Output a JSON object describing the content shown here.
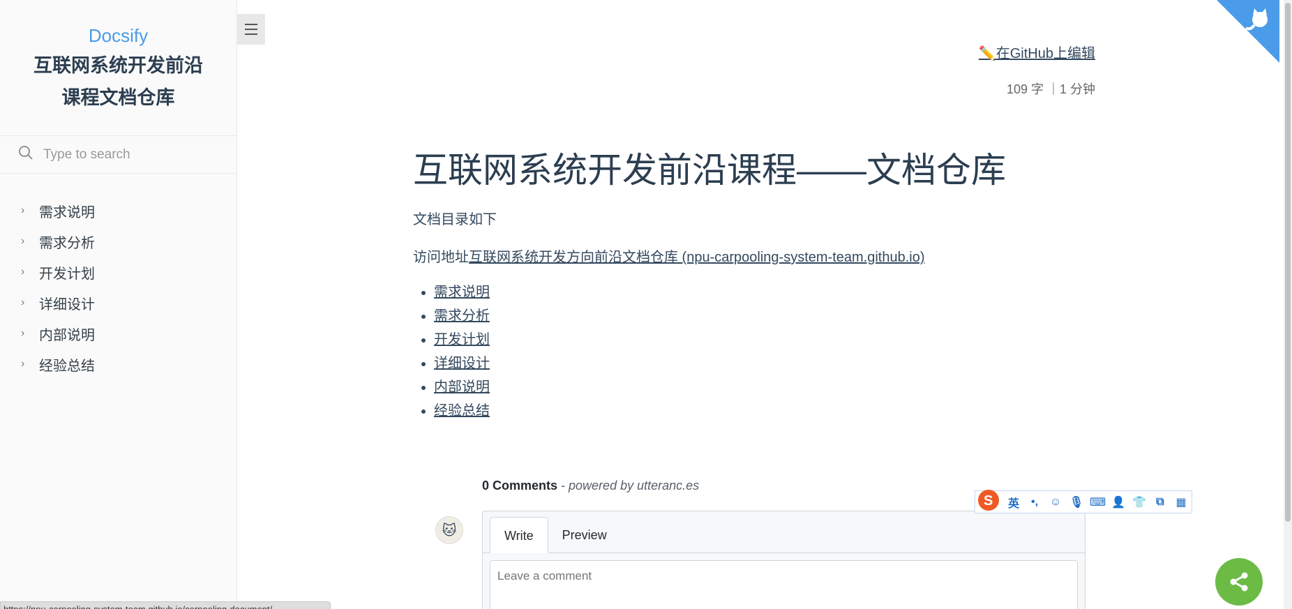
{
  "sidebar": {
    "brand": "Docsify",
    "subtitle_line1": "互联网系统开发前沿",
    "subtitle_line2": "课程文档仓库",
    "search_placeholder": "Type to search",
    "items": [
      {
        "label": "需求说明"
      },
      {
        "label": "需求分析"
      },
      {
        "label": "开发计划"
      },
      {
        "label": "详细设计"
      },
      {
        "label": "内部说明"
      },
      {
        "label": "经验总结"
      }
    ]
  },
  "main": {
    "edit_link": "在GitHub上编辑",
    "word_count": "109 字 ｜1 分钟",
    "title": "互联网系统开发前沿课程——文档仓库",
    "intro": "文档目录如下",
    "visit_prefix": "访问地址",
    "visit_link": "互联网系统开发方向前沿文档仓库 (npu-carpooling-system-team.github.io)",
    "docs": [
      {
        "label": "需求说明"
      },
      {
        "label": "需求分析"
      },
      {
        "label": "开发计划"
      },
      {
        "label": "详细设计"
      },
      {
        "label": "内部说明"
      },
      {
        "label": "经验总结"
      }
    ]
  },
  "comments": {
    "count_label": "0 Comments",
    "powered_by": " - powered by utteranc.es",
    "tab_write": "Write",
    "tab_preview": "Preview",
    "placeholder": "Leave a comment"
  },
  "ime": {
    "lang": "英",
    "punct": "•,"
  },
  "statusbar": {
    "url": "https://npu-carpooling-system-team.github.io/carpooling-document/"
  },
  "colors": {
    "brand": "#4a9be8",
    "sidebar_bg": "#fafafa",
    "share_green": "#6bbb45",
    "corner_blue": "#4a9be8"
  }
}
